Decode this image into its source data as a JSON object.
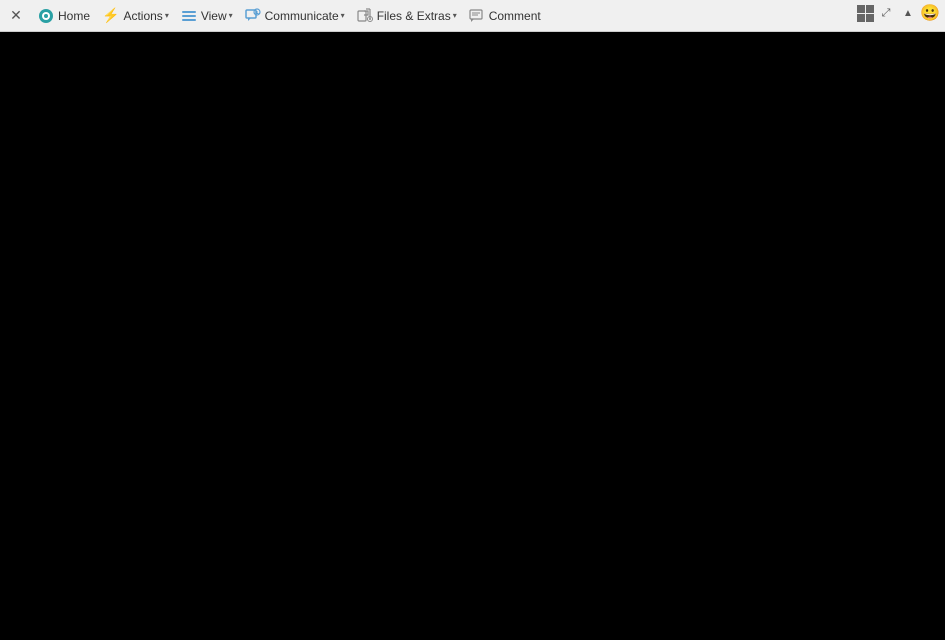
{
  "toolbar": {
    "close_label": "✕",
    "items": [
      {
        "id": "home",
        "label": "Home",
        "has_dropdown": false,
        "icon": "home-icon"
      },
      {
        "id": "actions",
        "label": "Actions",
        "has_dropdown": true,
        "icon": "lightning-icon"
      },
      {
        "id": "view",
        "label": "View",
        "has_dropdown": true,
        "icon": "view-icon"
      },
      {
        "id": "communicate",
        "label": "Communicate",
        "has_dropdown": true,
        "icon": "communicate-icon"
      },
      {
        "id": "files-extras",
        "label": "Files & Extras",
        "has_dropdown": true,
        "icon": "files-icon"
      },
      {
        "id": "comment",
        "label": "Comment",
        "has_dropdown": false,
        "icon": "comment-icon"
      }
    ]
  },
  "main": {
    "background": "#000000"
  }
}
